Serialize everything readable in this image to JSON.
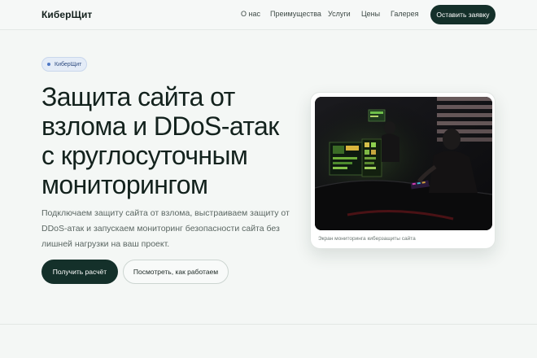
{
  "header": {
    "logo": "КиберЩит",
    "nav": [
      "О нас",
      "Преимущества",
      "Услуги",
      "Цены",
      "Галерея"
    ],
    "cta_label": "Оставить заявку"
  },
  "hero": {
    "badge_label": "КиберЩит",
    "title_lines": [
      "Защита сайта от",
      "взлома и DDoS-атак",
      "с круглосуточным",
      "мониторингом"
    ],
    "description_lines": [
      "Подключаем защиту сайта от взлома, выстраиваем защиту от",
      "DDoS-атак и запускаем мониторинг безопасности сайта без",
      "лишней нагрузки на ваш проект."
    ],
    "primary_button": "Получить расчёт",
    "secondary_button": "Посмотреть, как работаем",
    "image_caption": "Экран мониторинга киберзащиты сайта"
  },
  "colors": {
    "accent": "#14302a",
    "badge_bg": "#e4ecf7",
    "page_bg": "#f4f7f5"
  }
}
